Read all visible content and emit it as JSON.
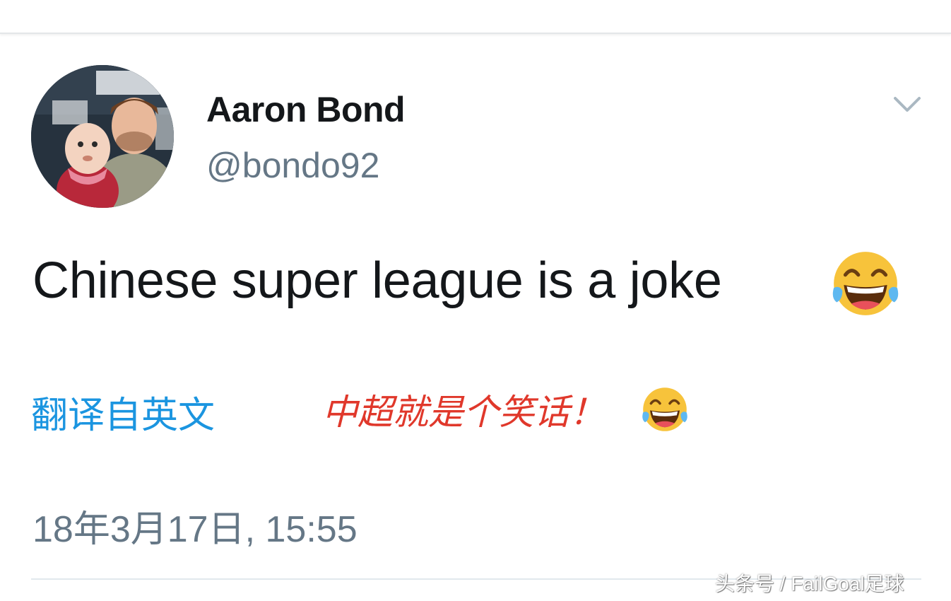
{
  "tweet": {
    "author": {
      "display_name": "Aaron Bond",
      "handle": "@bondo92",
      "avatar": "profile-photo"
    },
    "text": "Chinese super league is a joke",
    "emoji": "face-with-tears-of-joy",
    "translate_label": "翻译自英文",
    "timestamp": "18年3月17日, 15:55"
  },
  "annotation": {
    "text": "中超就是个笑话！",
    "emoji": "face-with-tears-of-joy",
    "color": "#e0382b"
  },
  "watermark": {
    "text": "头条号 / FailGoal足球"
  },
  "icons": {
    "menu": "chevron-down-icon"
  },
  "colors": {
    "primary_text": "#14171a",
    "secondary_text": "#657786",
    "link": "#1b95e0",
    "divider": "#e1e8ed"
  }
}
